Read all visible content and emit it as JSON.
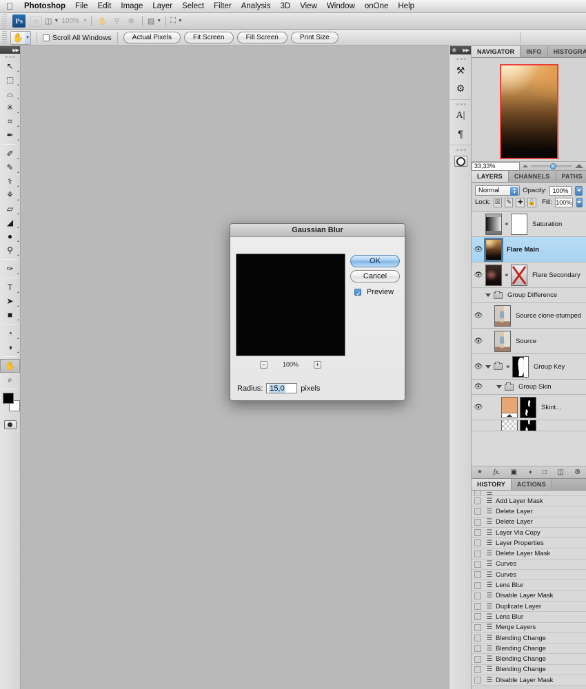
{
  "menubar": {
    "apple_icon": "apple-logo",
    "items": [
      {
        "label": "Photoshop",
        "bold": true
      },
      {
        "label": "File",
        "bold": false
      },
      {
        "label": "Edit",
        "bold": false
      },
      {
        "label": "Image",
        "bold": false
      },
      {
        "label": "Layer",
        "bold": false
      },
      {
        "label": "Select",
        "bold": false
      },
      {
        "label": "Filter",
        "bold": false
      },
      {
        "label": "Analysis",
        "bold": false
      },
      {
        "label": "3D",
        "bold": false
      },
      {
        "label": "View",
        "bold": false
      },
      {
        "label": "Window",
        "bold": false
      },
      {
        "label": "onOne",
        "bold": false
      },
      {
        "label": "Help",
        "bold": false
      }
    ]
  },
  "appbar": {
    "ps_badge": "Ps",
    "bridge_label": "Br",
    "zoom_level": "100%",
    "icons": [
      "bridge-icon",
      "view-extras-icon",
      "hand-icon",
      "zoom-icon",
      "rotate-view-icon",
      "screen-mode-icon",
      "arrange-documents-icon"
    ]
  },
  "optionsbar": {
    "active_tool_icon": "hand-tool-icon",
    "scroll_all_windows": "Scroll All Windows",
    "scroll_all_windows_checked": false,
    "buttons": [
      {
        "label": "Actual Pixels"
      },
      {
        "label": "Fit Screen"
      },
      {
        "label": "Fill Screen"
      },
      {
        "label": "Print Size"
      }
    ]
  },
  "toolbox": {
    "tools": [
      {
        "name": "move-tool",
        "glyph": "↖",
        "selected": false,
        "submenu": true
      },
      {
        "name": "marquee-tool",
        "glyph": "⬚",
        "selected": false,
        "submenu": true
      },
      {
        "name": "lasso-tool",
        "glyph": "⌓",
        "selected": false,
        "submenu": true
      },
      {
        "name": "quick-selection-tool",
        "glyph": "✳",
        "selected": false,
        "submenu": true
      },
      {
        "name": "crop-tool",
        "glyph": "⌗",
        "selected": false,
        "submenu": true
      },
      {
        "name": "eyedropper-tool",
        "glyph": "✒",
        "selected": false,
        "submenu": true
      },
      {
        "name": "healing-brush-tool",
        "glyph": "✐",
        "selected": false,
        "submenu": true
      },
      {
        "name": "brush-tool",
        "glyph": "✎",
        "selected": false,
        "submenu": true
      },
      {
        "name": "clone-stamp-tool",
        "glyph": "⚕",
        "selected": false,
        "submenu": true
      },
      {
        "name": "history-brush-tool",
        "glyph": "⚘",
        "selected": false,
        "submenu": true
      },
      {
        "name": "eraser-tool",
        "glyph": "▱",
        "selected": false,
        "submenu": true
      },
      {
        "name": "gradient-tool",
        "glyph": "◢",
        "selected": false,
        "submenu": true
      },
      {
        "name": "blur-tool",
        "glyph": "●",
        "selected": false,
        "submenu": true
      },
      {
        "name": "dodge-tool",
        "glyph": "⚲",
        "selected": false,
        "submenu": true
      },
      {
        "name": "pen-tool",
        "glyph": "✑",
        "selected": false,
        "submenu": true
      },
      {
        "name": "type-tool",
        "glyph": "T",
        "selected": false,
        "submenu": true
      },
      {
        "name": "path-selection-tool",
        "glyph": "➤",
        "selected": false,
        "submenu": true
      },
      {
        "name": "rectangle-shape-tool",
        "glyph": "■",
        "selected": false,
        "submenu": true
      },
      {
        "name": "3d-object-rotate-tool",
        "glyph": "◔",
        "selected": false,
        "submenu": true
      },
      {
        "name": "3d-camera-rotate-tool",
        "glyph": "◑",
        "selected": false,
        "submenu": true
      },
      {
        "name": "hand-tool",
        "glyph": "✋",
        "selected": true,
        "submenu": false
      },
      {
        "name": "zoom-tool",
        "glyph": "⌕",
        "selected": false,
        "submenu": false
      }
    ],
    "foreground_color": "#000000",
    "background_color": "#ffffff",
    "quick_mask_label": "quick-mask-icon"
  },
  "iconstrip": {
    "buttons": [
      {
        "name": "masks-panel-icon",
        "glyph": "⚒"
      },
      {
        "name": "adjustments-panel-icon",
        "glyph": "⚙"
      },
      {
        "name": "character-panel-icon",
        "glyph": "A"
      },
      {
        "name": "paragraph-panel-icon",
        "glyph": "¶"
      },
      {
        "name": "camera-raw-panel-icon",
        "glyph": "◉"
      }
    ]
  },
  "navigator": {
    "tabs": [
      {
        "label": "NAVIGATOR",
        "active": true
      },
      {
        "label": "INFO",
        "active": false
      },
      {
        "label": "HISTOGRAM",
        "active": false
      }
    ],
    "zoom_value": "33,33%",
    "thumbnail_name": "navigator-thumbnail",
    "view_box_color": "#e8403a"
  },
  "layers": {
    "tabs": [
      {
        "label": "LAYERS",
        "active": true
      },
      {
        "label": "CHANNELS",
        "active": false
      },
      {
        "label": "PATHS",
        "active": false
      }
    ],
    "blend_mode": "Normal",
    "opacity_label": "Opacity:",
    "opacity_value": "100%",
    "lock_label": "Lock:",
    "fill_label": "Fill:",
    "fill_value": "100%",
    "lock_icons": [
      "lock-transparent-pixels-icon",
      "lock-image-pixels-icon",
      "lock-position-icon",
      "lock-all-icon"
    ],
    "items": [
      {
        "type": "layer",
        "name": "Saturation",
        "visible": false,
        "selected": false,
        "thumb": "adjustment-levels-thumb",
        "mask": "white-mask-thumb",
        "linked": true
      },
      {
        "type": "layer",
        "name": "Flare Main",
        "visible": true,
        "selected": true,
        "thumb": "flare-main-thumb",
        "mask": "",
        "linked": false
      },
      {
        "type": "layer",
        "name": "Flare Secondary",
        "visible": true,
        "selected": false,
        "thumb": "flare-secondary-thumb",
        "mask": "disabled-mask-thumb",
        "linked": true
      },
      {
        "type": "group",
        "name": "Group Difference",
        "visible": false,
        "expanded": true,
        "indent": 0
      },
      {
        "type": "layer",
        "name": "Source clone-stumped",
        "visible": true,
        "selected": false,
        "thumb": "photo-person-thumb",
        "mask": "",
        "linked": false,
        "indent": 1
      },
      {
        "type": "layer",
        "name": "Source",
        "visible": true,
        "selected": false,
        "thumb": "photo-person-thumb",
        "mask": "",
        "linked": false,
        "indent": 1
      },
      {
        "type": "group",
        "name": "Group Key",
        "visible": true,
        "expanded": true,
        "indent": 0,
        "mask": "key-silhouette-mask",
        "linked": true
      },
      {
        "type": "group",
        "name": "Group Skin",
        "visible": true,
        "expanded": true,
        "indent": 1
      },
      {
        "type": "layer",
        "name": "Skint...",
        "visible": true,
        "selected": false,
        "thumb": "skin-solid-thumb",
        "mask": "skin-mask-thumb",
        "linked": false,
        "indent": 2
      }
    ],
    "footer_icons": [
      "link-layers-icon",
      "layer-style-fx-icon",
      "add-layer-mask-icon",
      "new-adjustment-layer-icon",
      "new-group-icon",
      "new-layer-icon",
      "delete-layer-icon"
    ]
  },
  "history": {
    "tabs": [
      {
        "label": "HISTORY",
        "active": true
      },
      {
        "label": "ACTIONS",
        "active": false
      }
    ],
    "items": [
      "Add Layer Mask",
      "Delete Layer",
      "Delete Layer",
      "Layer Via Copy",
      "Layer Properties",
      "Delete Layer Mask",
      "Curves",
      "Curves",
      "Lens Blur",
      "Disable Layer Mask",
      "Duplicate Layer",
      "Lens Blur",
      "Merge Layers",
      "Blending Change",
      "Blending Change",
      "Blending Change",
      "Blending Change",
      "Disable Layer Mask"
    ]
  },
  "dialog": {
    "title": "Gaussian Blur",
    "ok_label": "OK",
    "cancel_label": "Cancel",
    "preview_label": "Preview",
    "preview_checked": true,
    "zoom_out_label": "−",
    "zoom_in_label": "+",
    "zoom_percent": "100%",
    "radius_label": "Radius:",
    "radius_value": "15,0",
    "radius_unit": "pixels",
    "preview_thumb": "gaussian-blur-preview"
  }
}
